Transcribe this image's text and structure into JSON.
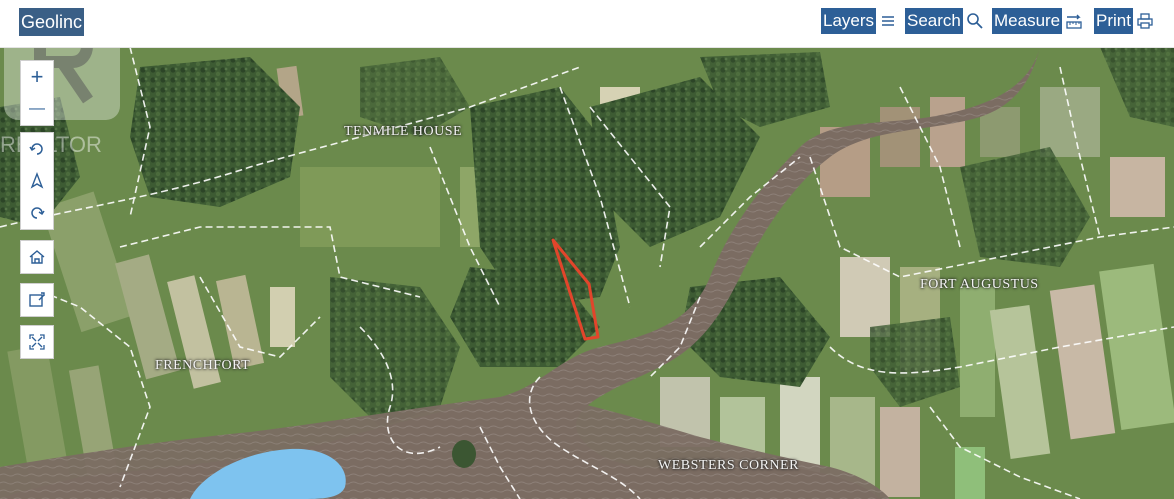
{
  "app": {
    "title": "Geolinc"
  },
  "toolbar": {
    "layers_label": "Layers",
    "search_label": "Search",
    "measure_label": "Measure",
    "print_label": "Print"
  },
  "map_controls": {
    "zoom_in": "+",
    "zoom_out": "—"
  },
  "map": {
    "place_labels": [
      {
        "id": "tenmile-house",
        "text": "TENMILE HOUSE"
      },
      {
        "id": "fort-augustus",
        "text": "FORT AUGUSTUS"
      },
      {
        "id": "frenchfort",
        "text": "FRENCHFORT"
      },
      {
        "id": "websters-corner",
        "text": "WEBSTERS CORNER"
      }
    ],
    "watermark_text": "REALTOR",
    "colors": {
      "river": "#7d6e64",
      "lake": "#7ec3ef",
      "parcel_outline": "#e2452b",
      "field": "#6f8f4c",
      "forest": "#334f2c",
      "boundary": "#ffffff"
    }
  },
  "icons": {
    "layers": "list-icon",
    "search": "magnifier-icon",
    "measure": "ruler-icon",
    "print": "printer-icon"
  }
}
